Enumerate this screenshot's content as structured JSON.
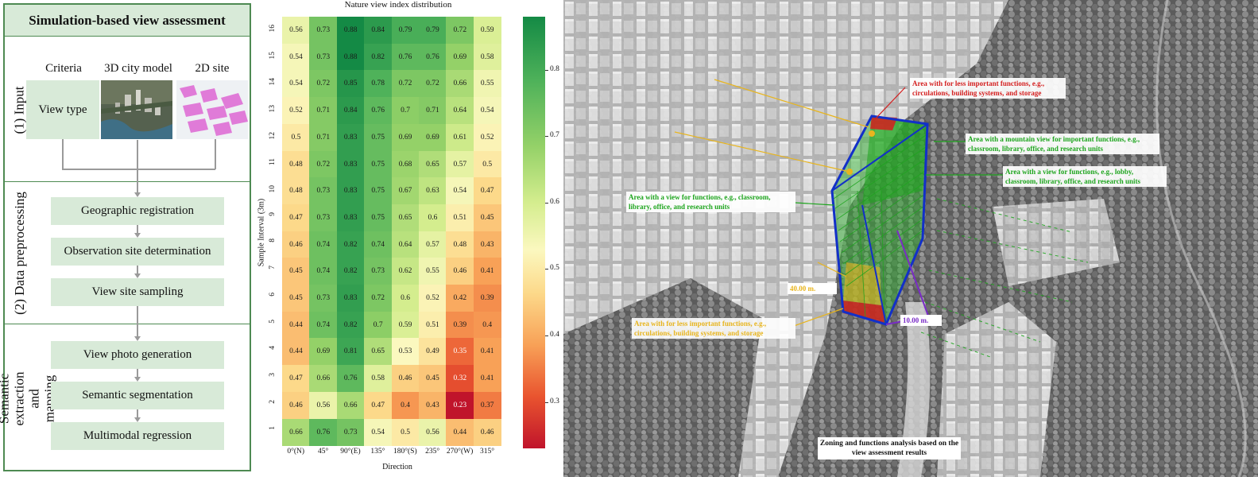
{
  "flowchart": {
    "title": "Simulation-based view assessment",
    "stages": [
      {
        "label": "(1) Input"
      },
      {
        "label": "(2) Data preprocessing"
      },
      {
        "label": "(3) Semantic extraction and mapping"
      }
    ],
    "input_columns": [
      "Criteria",
      "3D city model",
      "2D site"
    ],
    "criteria_box": "View type",
    "preprocessing_steps": [
      "Geographic registration",
      "Observation site determination",
      "View site sampling"
    ],
    "extraction_steps": [
      "View photo generation",
      "Semantic segmentation",
      "Multimodal regression"
    ]
  },
  "chart_data": {
    "type": "heatmap",
    "title": "Nature view index distribution",
    "xlabel": "Direction",
    "ylabel": "Sample Interval (3m)",
    "x": [
      "0°(N)",
      "45°",
      "90°(E)",
      "135°",
      "180°(S)",
      "235°",
      "270°(W)",
      "315°"
    ],
    "y": [
      16,
      15,
      14,
      13,
      12,
      11,
      10,
      9,
      8,
      7,
      6,
      5,
      4,
      3,
      2,
      1
    ],
    "values": [
      [
        0.56,
        0.73,
        0.88,
        0.84,
        0.79,
        0.79,
        0.72,
        0.59
      ],
      [
        0.54,
        0.73,
        0.88,
        0.82,
        0.76,
        0.76,
        0.69,
        0.58
      ],
      [
        0.54,
        0.72,
        0.85,
        0.78,
        0.72,
        0.72,
        0.66,
        0.55
      ],
      [
        0.52,
        0.71,
        0.84,
        0.76,
        0.7,
        0.71,
        0.64,
        0.54
      ],
      [
        0.5,
        0.71,
        0.83,
        0.75,
        0.69,
        0.69,
        0.61,
        0.52
      ],
      [
        0.48,
        0.72,
        0.83,
        0.75,
        0.68,
        0.65,
        0.57,
        0.5
      ],
      [
        0.48,
        0.73,
        0.83,
        0.75,
        0.67,
        0.63,
        0.54,
        0.47
      ],
      [
        0.47,
        0.73,
        0.83,
        0.75,
        0.65,
        0.6,
        0.51,
        0.45
      ],
      [
        0.46,
        0.74,
        0.82,
        0.74,
        0.64,
        0.57,
        0.48,
        0.43
      ],
      [
        0.45,
        0.74,
        0.82,
        0.73,
        0.62,
        0.55,
        0.46,
        0.41
      ],
      [
        0.45,
        0.73,
        0.83,
        0.72,
        0.6,
        0.52,
        0.42,
        0.39
      ],
      [
        0.44,
        0.74,
        0.82,
        0.7,
        0.59,
        0.51,
        0.39,
        0.4
      ],
      [
        0.44,
        0.69,
        0.81,
        0.65,
        0.53,
        0.49,
        0.35,
        0.41
      ],
      [
        0.47,
        0.66,
        0.76,
        0.58,
        0.46,
        0.45,
        0.32,
        0.41
      ],
      [
        0.46,
        0.56,
        0.66,
        0.47,
        0.4,
        0.43,
        0.23,
        0.37
      ],
      [
        0.66,
        0.76,
        0.73,
        0.54,
        0.5,
        0.56,
        0.44,
        0.46
      ]
    ],
    "colorbar": {
      "ticks": [
        0.3,
        0.4,
        0.5,
        0.6,
        0.7,
        0.8
      ],
      "range": [
        0.23,
        0.88
      ],
      "colormap": "RdYlGn"
    }
  },
  "map": {
    "callouts": {
      "red": "Area with for less important functions, e.g., circulations, building systems, and storage",
      "mountain": "Area with a mountain view for important functions, e.g., classroom, library, office, and research units",
      "lobby": "Area with a view for functions, e.g., lobby, classroom, library, office, and research units",
      "classroom": "Area with a view for functions, e.g., classroom, library, office, and research units",
      "yellow": "Area with for less important functions, e.g., circulations, building systems, and storage",
      "height": "40.00 m.",
      "width": "10.00 m."
    },
    "caption": "Zoning and functions analysis based on the view assessment results",
    "colors": {
      "red": "#d41f1f",
      "green": "#1ea51e",
      "yellow": "#e8b51e",
      "purple": "#7a2cc7",
      "blue": "#1230c8"
    }
  }
}
